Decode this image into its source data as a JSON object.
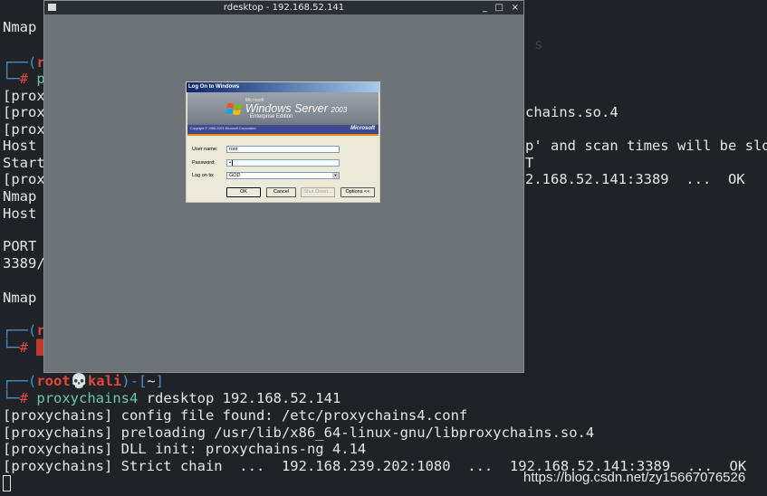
{
  "terminal": {
    "lines": {
      "nmap1": "Nmap",
      "p_marker": "p",
      "prox1": "[prox",
      "prox2": "[prox",
      "prox3": "[prox",
      "host1": "Host",
      "start": "Start",
      "prox4": "[prox",
      "nmap2": "Nmap",
      "host2": "Host",
      "port": "PORT",
      "p3389": "3389/",
      "nmap3": "Nmap",
      "right_chains": "chains.so.4",
      "right_scan": "p' and scan times will be slo",
      "right_t": "T",
      "right_ok": "2.168.52.141:3389  ...  OK"
    },
    "prompt": {
      "open": "┌──(",
      "user": "root",
      "skull": "💀",
      "host": "kali",
      "mid": ")-[",
      "dir": "~",
      "close": "]",
      "second": "└─",
      "hash": "#",
      "command_bin": "proxychains4",
      "command_args": " rdesktop 192.168.52.141"
    },
    "output": [
      "[proxychains] config file found: /etc/proxychains4.conf",
      "[proxychains] preloading /usr/lib/x86_64-linux-gnu/libproxychains.so.4",
      "[proxychains] DLL init: proxychains-ng 4.14",
      "[proxychains] Strict chain  ...  192.168.239.202:1080  ...  192.168.52.141:3389  ...  OK"
    ]
  },
  "rdesktop": {
    "title": "rdesktop - 192.168.52.141",
    "ctrl_min": "_",
    "ctrl_max": "□",
    "ctrl_close": "×"
  },
  "logon": {
    "title": "Log On to Windows",
    "brand_small": "Microsoft",
    "brand_name": "Windows Server",
    "brand_year": "2003",
    "edition": "Enterprise Edition",
    "copyright": "Copyright © 1985-2003  Microsoft Corporation",
    "ms_logo": "Microsoft",
    "username_label": "User name:",
    "username_value": "root",
    "password_label": "Password:",
    "password_value": "•",
    "logon_to_label": "Log on to:",
    "logon_to_value": "GOD",
    "ok_button": "OK",
    "cancel_button": "Cancel",
    "shutdown_button": "Shut Down...",
    "options_button": "Options <<"
  },
  "watermark": "https://blog.csdn.net/zy15667076526"
}
